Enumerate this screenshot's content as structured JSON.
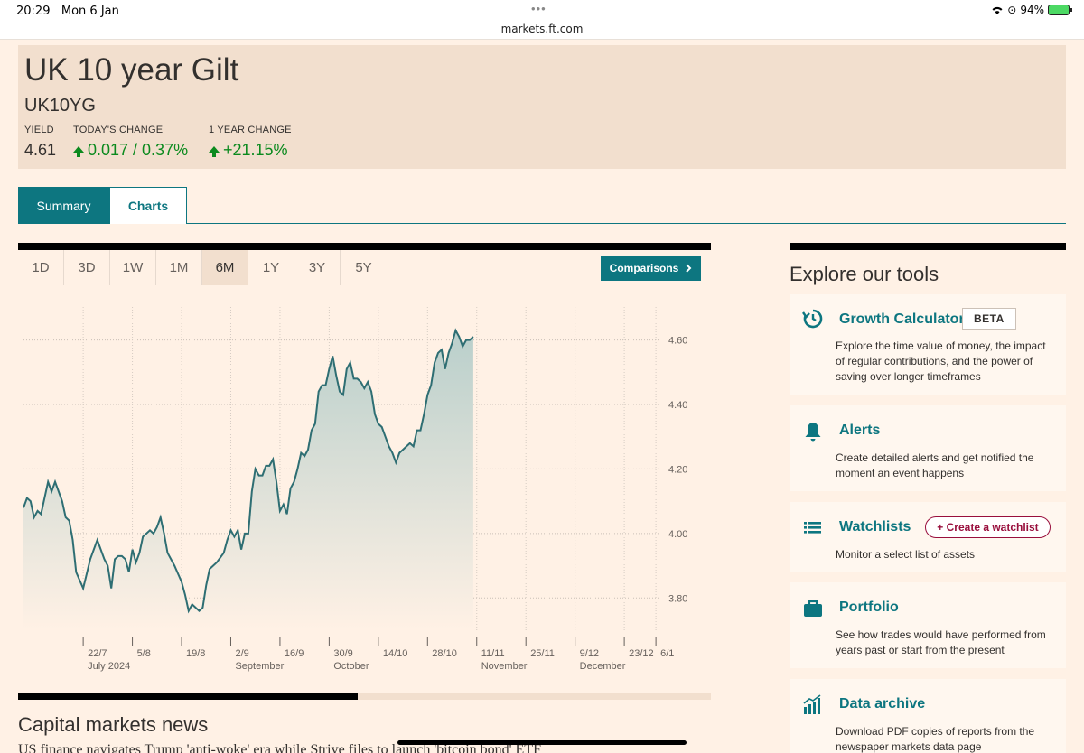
{
  "status_bar": {
    "time": "20:29",
    "date": "Mon 6 Jan",
    "url": "markets.ft.com",
    "dots": "•••",
    "battery": "94%"
  },
  "security": {
    "name": "UK 10 year Gilt",
    "ticker": "UK10YG",
    "yield_label": "YIELD",
    "yield_value": "4.61",
    "today_label": "TODAY'S CHANGE",
    "today_value": "0.017 / 0.37%",
    "year_label": "1 YEAR CHANGE",
    "year_value": "+21.15%"
  },
  "tabs": [
    "Summary",
    "Charts"
  ],
  "ranges": {
    "items": [
      "1D",
      "3D",
      "1W",
      "1M",
      "6M",
      "1Y",
      "3Y",
      "5Y"
    ],
    "selected": "6M"
  },
  "comparisons_label": "Comparisons",
  "chart_data": {
    "type": "area",
    "ylim": [
      3.7,
      4.68
    ],
    "y_ticks": [
      3.8,
      4.0,
      4.2,
      4.4,
      4.6
    ],
    "y_tick_labels": [
      "3.80",
      "4.00",
      "4.20",
      "4.40",
      "4.60"
    ],
    "x_ticks": [
      {
        "day": 17,
        "label": "22/7",
        "sub": "July 2024"
      },
      {
        "day": 31,
        "label": "5/8",
        "sub": ""
      },
      {
        "day": 45,
        "label": "19/8",
        "sub": ""
      },
      {
        "day": 59,
        "label": "2/9",
        "sub": "September"
      },
      {
        "day": 73,
        "label": "16/9",
        "sub": ""
      },
      {
        "day": 87,
        "label": "30/9",
        "sub": "October"
      },
      {
        "day": 101,
        "label": "14/10",
        "sub": ""
      },
      {
        "day": 115,
        "label": "28/10",
        "sub": ""
      },
      {
        "day": 129,
        "label": "11/11",
        "sub": "November"
      },
      {
        "day": 143,
        "label": "25/11",
        "sub": ""
      },
      {
        "day": 157,
        "label": "9/12",
        "sub": "December"
      },
      {
        "day": 171,
        "label": "23/12",
        "sub": ""
      },
      {
        "day": 180,
        "label": "6/1",
        "sub": ""
      }
    ],
    "x_range": [
      0,
      181
    ],
    "points": [
      [
        0,
        4.08
      ],
      [
        1,
        4.11
      ],
      [
        2,
        4.1
      ],
      [
        3,
        4.05
      ],
      [
        4,
        4.07
      ],
      [
        5,
        4.06
      ],
      [
        6,
        4.11
      ],
      [
        7,
        4.16
      ],
      [
        8,
        4.13
      ],
      [
        9,
        4.16
      ],
      [
        10,
        4.13
      ],
      [
        11,
        4.1
      ],
      [
        12,
        4.05
      ],
      [
        13,
        4.04
      ],
      [
        14,
        3.98
      ],
      [
        15,
        3.88
      ],
      [
        17,
        3.83
      ],
      [
        19,
        3.92
      ],
      [
        21,
        3.98
      ],
      [
        23,
        3.92
      ],
      [
        24,
        3.9
      ],
      [
        25,
        3.83
      ],
      [
        26,
        3.92
      ],
      [
        27,
        3.93
      ],
      [
        28,
        3.93
      ],
      [
        29,
        3.92
      ],
      [
        30,
        3.88
      ],
      [
        31,
        3.95
      ],
      [
        32,
        3.91
      ],
      [
        33,
        3.94
      ],
      [
        34,
        3.99
      ],
      [
        35,
        4.0
      ],
      [
        36,
        4.01
      ],
      [
        37,
        4.0
      ],
      [
        38,
        4.02
      ],
      [
        39,
        4.05
      ],
      [
        40,
        4.0
      ],
      [
        41,
        3.94
      ],
      [
        43,
        3.9
      ],
      [
        45,
        3.85
      ],
      [
        46,
        3.81
      ],
      [
        47,
        3.76
      ],
      [
        48,
        3.78
      ],
      [
        49,
        3.77
      ],
      [
        50,
        3.76
      ],
      [
        51,
        3.77
      ],
      [
        52,
        3.84
      ],
      [
        53,
        3.89
      ],
      [
        55,
        3.91
      ],
      [
        57,
        3.94
      ],
      [
        58,
        3.98
      ],
      [
        59,
        4.01
      ],
      [
        60,
        3.99
      ],
      [
        61,
        4.01
      ],
      [
        62,
        3.95
      ],
      [
        63,
        4.0
      ],
      [
        64,
        4.0
      ],
      [
        65,
        4.13
      ],
      [
        66,
        4.2
      ],
      [
        67,
        4.18
      ],
      [
        68,
        4.18
      ],
      [
        69,
        4.21
      ],
      [
        70,
        4.21
      ],
      [
        71,
        4.23
      ],
      [
        72,
        4.16
      ],
      [
        73,
        4.07
      ],
      [
        74,
        4.09
      ],
      [
        75,
        4.06
      ],
      [
        76,
        4.14
      ],
      [
        77,
        4.16
      ],
      [
        78,
        4.2
      ],
      [
        79,
        4.25
      ],
      [
        80,
        4.24
      ],
      [
        81,
        4.26
      ],
      [
        82,
        4.32
      ],
      [
        83,
        4.34
      ],
      [
        84,
        4.44
      ],
      [
        85,
        4.46
      ],
      [
        86,
        4.46
      ],
      [
        87,
        4.51
      ],
      [
        88,
        4.55
      ],
      [
        89,
        4.49
      ],
      [
        90,
        4.44
      ],
      [
        91,
        4.43
      ],
      [
        92,
        4.51
      ],
      [
        93,
        4.53
      ],
      [
        94,
        4.48
      ],
      [
        95,
        4.48
      ],
      [
        96,
        4.47
      ],
      [
        97,
        4.45
      ],
      [
        98,
        4.47
      ],
      [
        99,
        4.44
      ],
      [
        100,
        4.37
      ],
      [
        101,
        4.34
      ],
      [
        102,
        4.33
      ],
      [
        103,
        4.3
      ],
      [
        104,
        4.27
      ],
      [
        105,
        4.25
      ],
      [
        106,
        4.22
      ],
      [
        107,
        4.25
      ],
      [
        108,
        4.26
      ],
      [
        109,
        4.27
      ],
      [
        110,
        4.28
      ],
      [
        111,
        4.27
      ],
      [
        112,
        4.32
      ],
      [
        113,
        4.32
      ],
      [
        114,
        4.37
      ],
      [
        115,
        4.43
      ],
      [
        116,
        4.46
      ],
      [
        117,
        4.53
      ],
      [
        118,
        4.56
      ],
      [
        119,
        4.57
      ],
      [
        120,
        4.51
      ],
      [
        121,
        4.56
      ],
      [
        122,
        4.59
      ],
      [
        123,
        4.63
      ],
      [
        124,
        4.61
      ],
      [
        125,
        4.58
      ],
      [
        126,
        4.6
      ],
      [
        127,
        4.6
      ],
      [
        128,
        4.61
      ]
    ],
    "line_color": "#2e6e73",
    "fill_top": "#b9cfcb",
    "fill_bottom": "#fff1e5",
    "grid": true
  },
  "news": {
    "title": "Capital markets news",
    "headline_line": "US finance navigates Trump 'anti-woke' era while    Strive files to launch 'bitcoin bond' ETF"
  },
  "tools": {
    "title": "Explore our tools",
    "cards": [
      {
        "title": "Growth Calculator",
        "badge": "BETA",
        "desc": "Explore the time value of money, the impact of regular contributions, and the power of saving over longer timeframes"
      },
      {
        "title": "Alerts",
        "desc": "Create detailed alerts and get notified the moment an event happens"
      },
      {
        "title": "Watchlists",
        "action": "+ Create a watchlist",
        "desc": "Monitor a select list of assets"
      },
      {
        "title": "Portfolio",
        "desc": "See how trades would have performed from years past or start from the present"
      },
      {
        "title": "Data archive",
        "desc": "Download PDF copies of reports from the newspaper markets data page"
      }
    ]
  }
}
